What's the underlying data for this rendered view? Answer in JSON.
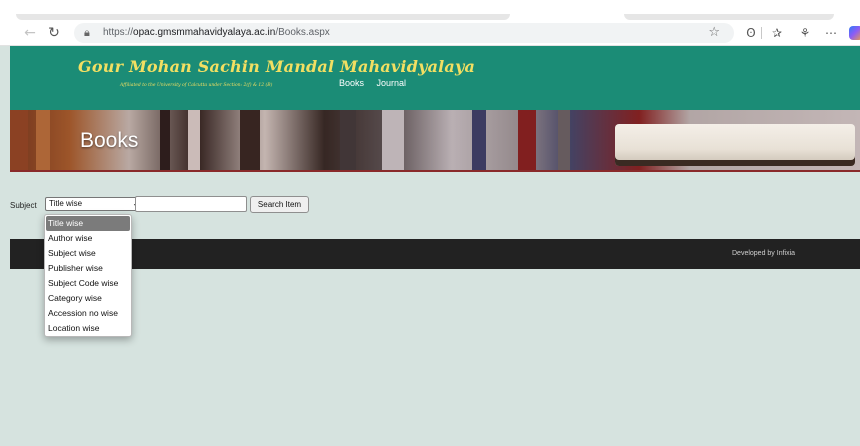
{
  "browser": {
    "url_prefix": "https://",
    "url_host": "opac.gmsmmahavidyalaya.ac.in",
    "url_path": "/Books.aspx",
    "icons": [
      "back-icon",
      "refresh-icon",
      "lock-icon",
      "favorite-star-icon",
      "reader-icon",
      "favorites-icon",
      "extension-icon",
      "more-icon",
      "copilot-icon"
    ]
  },
  "site": {
    "college_name": "Gour Mohan Sachin Mandal Mahavidyalaya",
    "affiliation": "Affiliated to the University of Calcutta under Section: 2(f) & 12 (B)",
    "nav": [
      "Books",
      "Journal"
    ],
    "banner_title": "Books"
  },
  "form": {
    "subject_label": "Subject",
    "selected_option": "Title wise",
    "search_value": "",
    "search_button": "Search Item",
    "options": [
      "Title wise",
      "Author wise",
      "Subject wise",
      "Publisher wise",
      "Subject Code wise",
      "Category wise",
      "Accession no wise",
      "Location wise"
    ]
  },
  "footer": {
    "credit": "Developed by   Infixia"
  },
  "colors": {
    "header_green": "#1b8c76",
    "title_gold": "#f2df62",
    "page_bg": "#d6e3df",
    "footer_bg": "#222222",
    "selected_option_bg": "#7b7b7b"
  }
}
